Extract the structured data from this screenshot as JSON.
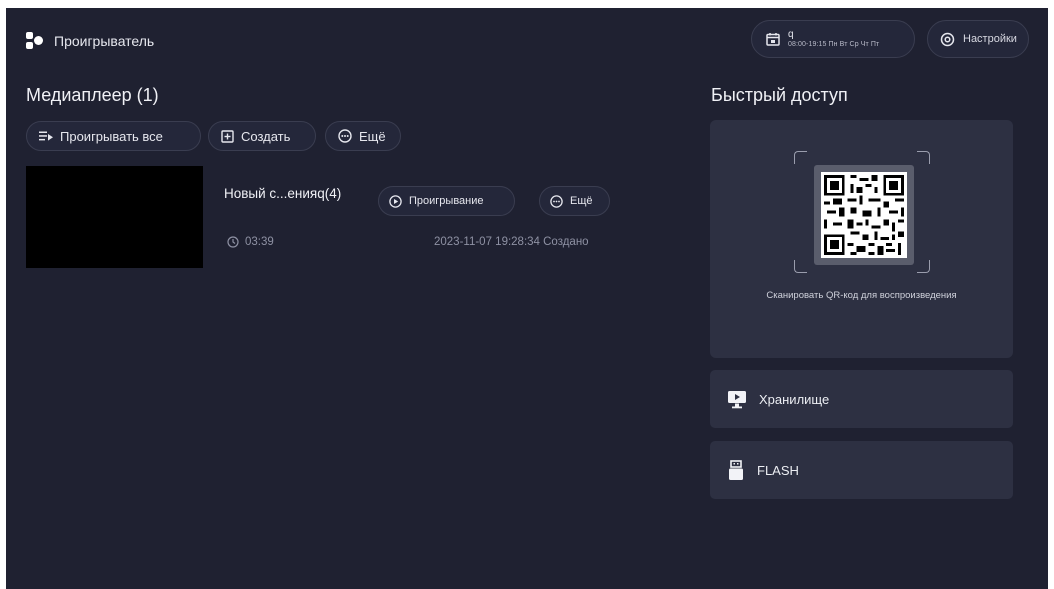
{
  "header": {
    "app_title": "Проигрыватель",
    "schedule": {
      "name": "q",
      "time": "08:00-19:15  Пн Вт Ср Чт Пт"
    },
    "settings_label": "Настройки"
  },
  "media": {
    "title": "Медиаплеер (1)",
    "actions": {
      "play_all": "Проигрывать все",
      "create": "Создать",
      "more": "Ещё"
    },
    "items": [
      {
        "name": "Новый с...енияq(4)",
        "play_label": "Проигрывание",
        "more_label": "Ещё",
        "duration": "03:39",
        "created": "2023-11-07 19:28:34 Создано"
      }
    ]
  },
  "quick": {
    "title": "Быстрый доступ",
    "qr_caption": "Сканировать QR-код для воспроизведения",
    "storage_label": "Хранилище",
    "flash_label": "FLASH"
  },
  "colors": {
    "background": "#1f2131",
    "card": "#2d3042",
    "pill": "#24273a",
    "border": "#3a3d50"
  }
}
